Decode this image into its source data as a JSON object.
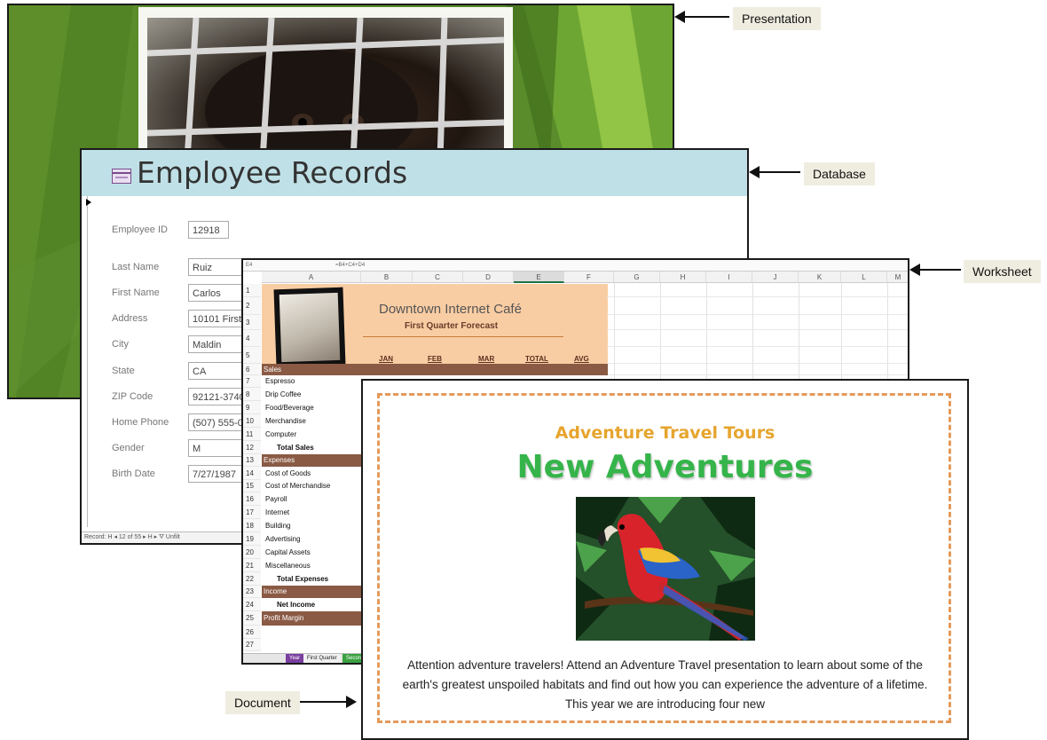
{
  "callouts": {
    "presentation": "Presentation",
    "database": "Database",
    "worksheet": "Worksheet",
    "document": "Document"
  },
  "database": {
    "title": "Employee Records",
    "fields": [
      {
        "label": "Employee ID",
        "value": "12918"
      },
      {
        "label": "Last Name",
        "value": "Ruiz"
      },
      {
        "label": "First Name",
        "value": "Carlos"
      },
      {
        "label": "Address",
        "value": "10101 First"
      },
      {
        "label": "City",
        "value": "Maldin"
      },
      {
        "label": "State",
        "value": "CA"
      },
      {
        "label": "ZIP Code",
        "value": "92121-3740"
      },
      {
        "label": "Home Phone",
        "value": "(507) 555-0"
      },
      {
        "label": "Gender",
        "value": "M"
      },
      {
        "label": "Birth Date",
        "value": "7/27/1987"
      }
    ],
    "navbar": "Record: H ◂ 12 of 55 ▸ H ▸ ⛛ Unfilt"
  },
  "worksheet": {
    "name_box": "E4",
    "formula": "=B4+C4+D4",
    "columns": [
      "A",
      "B",
      "C",
      "D",
      "E",
      "F",
      "G",
      "H",
      "I",
      "J",
      "K",
      "L",
      "M"
    ],
    "title": "Downtown Internet Café",
    "subtitle": "First Quarter Forecast",
    "month_headers": [
      "JAN",
      "FEB",
      "MAR",
      "TOTAL",
      "AVG"
    ],
    "rows": [
      {
        "n": "1",
        "text": "",
        "style": ""
      },
      {
        "n": "2",
        "text": "",
        "style": ""
      },
      {
        "n": "3",
        "text": "",
        "style": ""
      },
      {
        "n": "4",
        "text": "",
        "style": ""
      },
      {
        "n": "5",
        "text": "",
        "style": ""
      },
      {
        "n": "6",
        "text": "Sales",
        "style": "band"
      },
      {
        "n": "7",
        "text": "Espresso",
        "style": ""
      },
      {
        "n": "8",
        "text": "Drip Coffee",
        "style": ""
      },
      {
        "n": "9",
        "text": "Food/Beverage",
        "style": ""
      },
      {
        "n": "10",
        "text": "Merchandise",
        "style": ""
      },
      {
        "n": "11",
        "text": "Computer",
        "style": ""
      },
      {
        "n": "12",
        "text": "Total Sales",
        "style": "bold"
      },
      {
        "n": "13",
        "text": "Expenses",
        "style": "band"
      },
      {
        "n": "14",
        "text": "Cost of Goods",
        "style": ""
      },
      {
        "n": "15",
        "text": "Cost of Merchandise",
        "style": ""
      },
      {
        "n": "16",
        "text": "Payroll",
        "style": ""
      },
      {
        "n": "17",
        "text": "Internet",
        "style": ""
      },
      {
        "n": "18",
        "text": "Building",
        "style": ""
      },
      {
        "n": "19",
        "text": "Advertising",
        "style": ""
      },
      {
        "n": "20",
        "text": "Capital Assets",
        "style": ""
      },
      {
        "n": "21",
        "text": "Miscellaneous",
        "style": ""
      },
      {
        "n": "22",
        "text": "Total Expenses",
        "style": "bold"
      },
      {
        "n": "23",
        "text": "Income",
        "style": "band"
      },
      {
        "n": "24",
        "text": "Net Income",
        "style": "bold"
      },
      {
        "n": "25",
        "text": "Profit Margin",
        "style": "band"
      },
      {
        "n": "26",
        "text": "",
        "style": ""
      },
      {
        "n": "27",
        "text": "",
        "style": ""
      }
    ],
    "sheet_tabs": [
      "Year",
      "First Quarter",
      "Second"
    ]
  },
  "document": {
    "subtitle": "Adventure Travel Tours",
    "title": "New Adventures",
    "body": "Attention adventure travelers! Attend an Adventure Travel presentation to learn about some of the earth's greatest unspoiled habitats and find out how you can experience the adventure of a lifetime. This year we are introducing four new"
  },
  "colors": {
    "pres_green": "#5a8c2b",
    "db_header": "#bfe0e6",
    "ws_band": "#8a5a44",
    "ws_header": "#f9cda3",
    "doc_title": "#35b44a",
    "doc_subtitle": "#e6a52e",
    "doc_border": "#e49a5a"
  }
}
